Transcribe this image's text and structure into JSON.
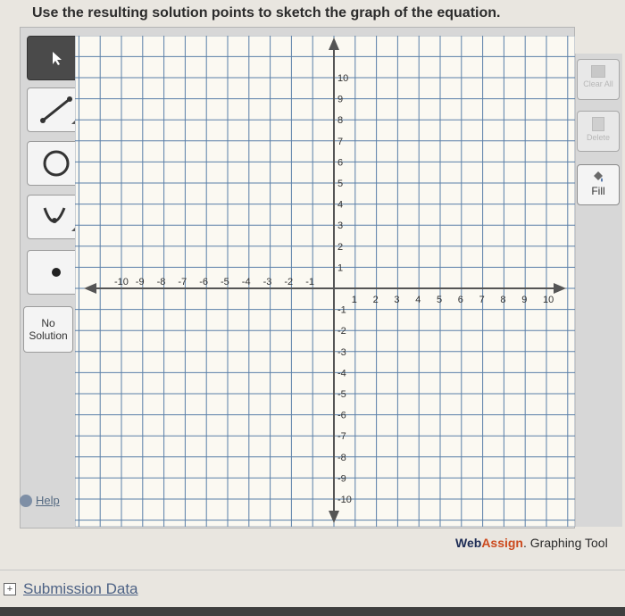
{
  "instruction": "Use the resulting solution points to sketch the graph of the equation.",
  "tools": {
    "no_solution": "No\nSolution",
    "help": "Help"
  },
  "right_tools": {
    "clear_all": "Clear All",
    "delete": "Delete",
    "fill": "Fill"
  },
  "graph": {
    "x_labels": [
      "-10",
      "-9",
      "-8",
      "-7",
      "-6",
      "-5",
      "-4",
      "-3",
      "-2",
      "-1",
      "1",
      "2",
      "3",
      "4",
      "5",
      "6",
      "7",
      "8",
      "9",
      "10"
    ],
    "y_labels": [
      "10",
      "9",
      "8",
      "7",
      "6",
      "5",
      "4",
      "3",
      "2",
      "1",
      "-1",
      "-2",
      "-3",
      "-4",
      "-5",
      "-6",
      "-7",
      "-8",
      "-9",
      "-10"
    ],
    "x_range": [
      -10,
      10
    ],
    "y_range": [
      -10,
      10
    ]
  },
  "brand": {
    "web": "Web",
    "assign": "Assign",
    "suffix": ". Graphing Tool"
  },
  "submission_data": "Submission Data"
}
